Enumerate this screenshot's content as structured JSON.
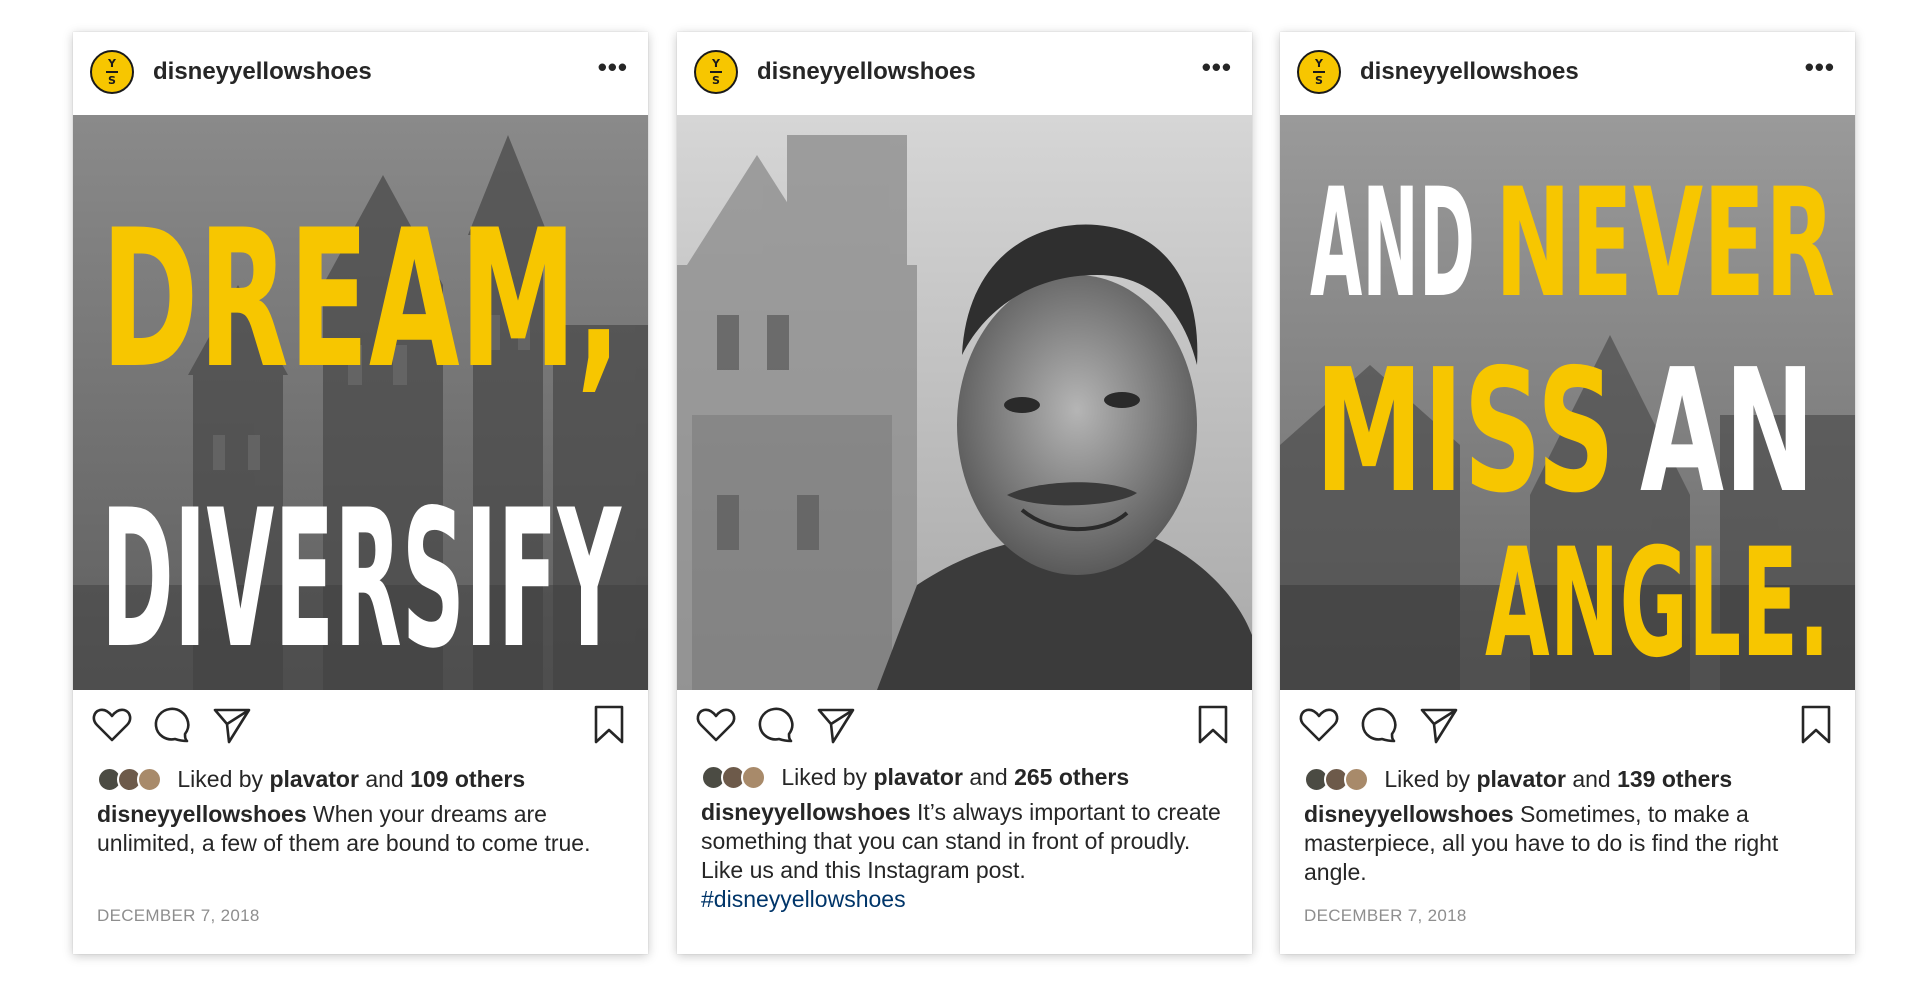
{
  "posts": [
    {
      "username": "disneyyellowshoes",
      "avatar": {
        "top": "Y",
        "bottom": "S"
      },
      "more_icon": "•••",
      "photo_overlay": {
        "line1": "DREAM,",
        "line2": "DIVERSIFY"
      },
      "liked_prefix": "Liked by",
      "liked_user": "plavator",
      "liked_and": "and",
      "liked_others": "109 others",
      "caption_user": "disneyyellowshoes",
      "caption_text": "When your dreams are unlimited, a few of them are bound to come true.",
      "date": "DECEMBER 7, 2018"
    },
    {
      "username": "disneyyellowshoes",
      "avatar": {
        "top": "Y",
        "bottom": "S"
      },
      "more_icon": "•••",
      "liked_prefix": "Liked by",
      "liked_user": "plavator",
      "liked_and": "and",
      "liked_others": "265 others",
      "caption_user": "disneyyellowshoes",
      "caption_text": "It’s always important to create something that you can stand in front of proudly. Like us and this Instagram post.",
      "hashtag": "#disneyyellowshoes"
    },
    {
      "username": "disneyyellowshoes",
      "avatar": {
        "top": "Y",
        "bottom": "S"
      },
      "more_icon": "•••",
      "photo_overlay": {
        "line1a": "AND",
        "line1b": "NEVER",
        "line2a": "MISS",
        "line2b": "AN",
        "line3": "ANGLE."
      },
      "liked_prefix": "Liked by",
      "liked_user": "plavator",
      "liked_and": "and",
      "liked_others": "139 others",
      "caption_user": "disneyyellowshoes",
      "caption_text": "Sometimes, to make a masterpiece, all you have to do is find the right angle.",
      "date": "DECEMBER 7, 2018"
    }
  ],
  "colors": {
    "brand_yellow": "#f7c600",
    "text": "#262626",
    "muted": "#8e8e8e",
    "hashtag": "#003569"
  },
  "icons": [
    "heart-icon",
    "comment-icon",
    "share-icon",
    "bookmark-icon",
    "more-options-icon"
  ]
}
